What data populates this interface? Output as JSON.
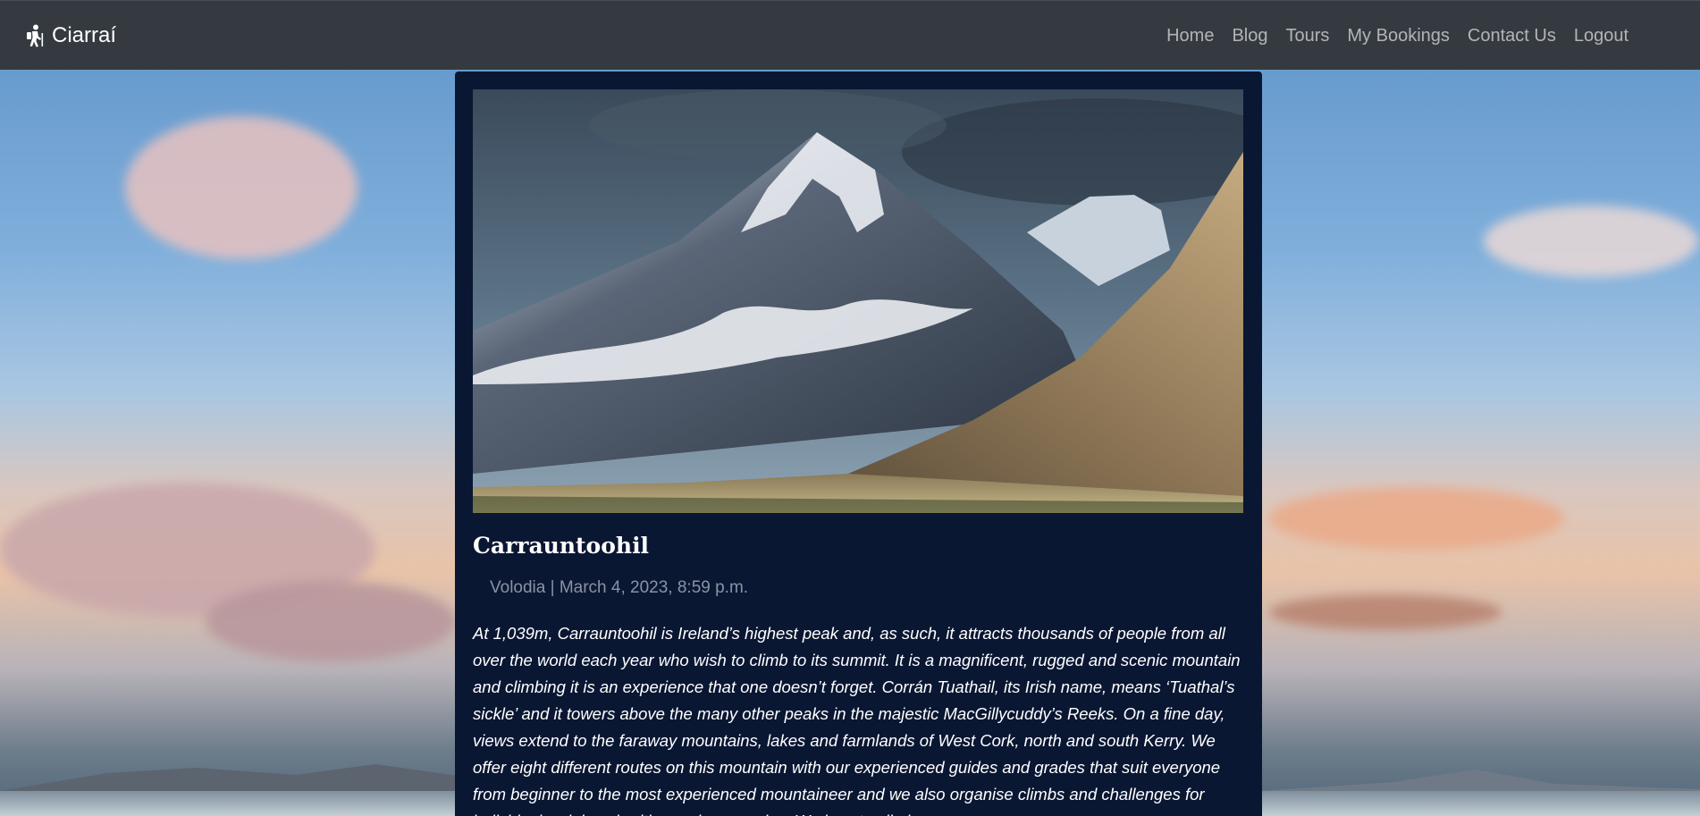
{
  "navbar": {
    "brand": "Ciarraí",
    "links": [
      "Home",
      "Blog",
      "Tours",
      "My Bookings",
      "Contact Us",
      "Logout"
    ]
  },
  "post": {
    "title": "Carrauntoohil",
    "meta": "Volodia | March 4, 2023, 8:59 p.m.",
    "body": "At 1,039m, Carrauntoohil is Ireland’s highest peak and, as such, it attracts thousands of people from all over the world each year who wish to climb to its summit. It is a magnificent, rugged and scenic mountain and climbing it is an experience that one doesn’t forget. Corrán Tuathail, its Irish name, means ‘Tuathal’s sickle’ and it towers above the many other peaks in the majestic MacGillycuddy’s Reeks. On a fine day, views extend to the faraway mountains, lakes and farmlands of West Cork, north and south Kerry. We offer eight different routes on this mountain with our experienced guides and grades that suit everyone from beginner to the most experienced mountaineer and we also organise climbs and challenges for individuals, clubs, charities and companies. We love to climb"
  },
  "colors": {
    "navbar_bg": "#343a40",
    "card_bg": "#0a1733",
    "nav_link": "rgba(255,255,255,0.62)",
    "meta_text": "#8a93a3"
  },
  "icons": {
    "brand_icon": "hiking-person-icon"
  }
}
